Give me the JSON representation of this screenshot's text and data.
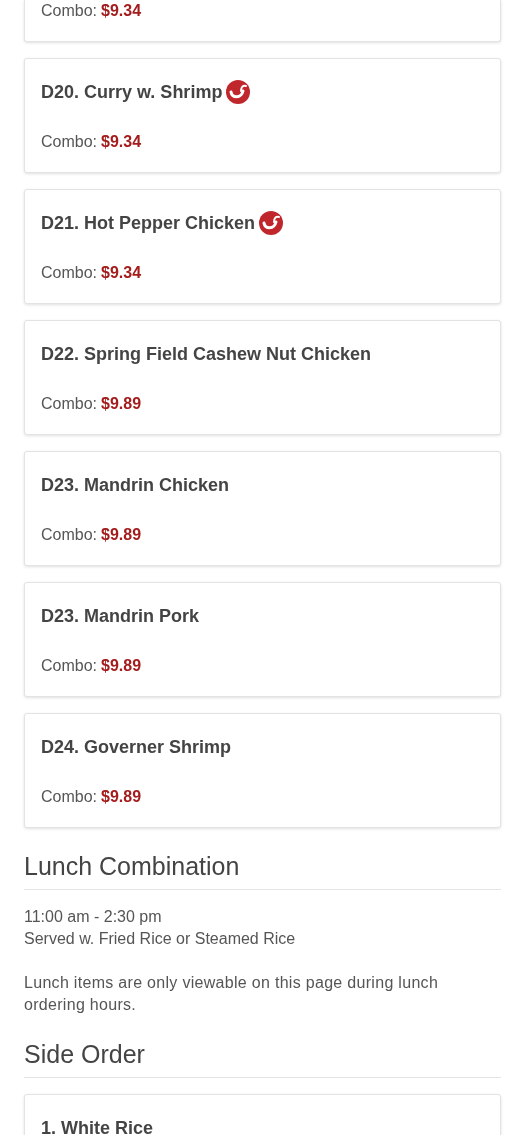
{
  "sections": [
    {
      "kind": "items",
      "items": [
        {
          "partial": true,
          "combo_label": "Combo:",
          "price": "$9.34"
        },
        {
          "name": "D20. Curry w. Shrimp",
          "spicy": true,
          "combo_label": "Combo:",
          "price": "$9.34"
        },
        {
          "name": "D21. Hot Pepper Chicken",
          "spicy": true,
          "combo_label": "Combo:",
          "price": "$9.34"
        },
        {
          "name": "D22. Spring Field Cashew Nut Chicken",
          "spicy": false,
          "combo_label": "Combo:",
          "price": "$9.89"
        },
        {
          "name": "D23. Mandrin Chicken",
          "spicy": false,
          "combo_label": "Combo:",
          "price": "$9.89"
        },
        {
          "name": "D23. Mandrin Pork",
          "spicy": false,
          "combo_label": "Combo:",
          "price": "$9.89"
        },
        {
          "name": "D24. Governer Shrimp",
          "spicy": false,
          "combo_label": "Combo:",
          "price": "$9.89"
        }
      ]
    },
    {
      "kind": "info",
      "title": "Lunch Combination",
      "hours": "11:00 am - 2:30 pm",
      "served": "Served w. Fried Rice or Steamed Rice",
      "note": "Lunch items are only viewable on this page during lunch ordering hours."
    },
    {
      "kind": "items",
      "title": "Side Order",
      "items": [
        {
          "name": "1. White Rice",
          "spicy": false
        }
      ]
    }
  ]
}
